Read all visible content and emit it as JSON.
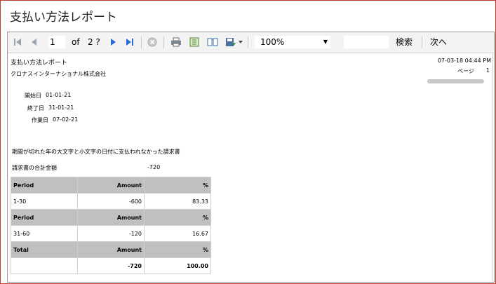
{
  "window": {
    "title": "支払い方法レポート"
  },
  "toolbar": {
    "page_current": "1",
    "page_of": "of",
    "page_total": "2 ?",
    "zoom": "100%",
    "find_label": "検索",
    "next_label": "次へ",
    "icons": [
      "first-page-icon",
      "previous-page-icon",
      "next-page-icon",
      "last-page-icon",
      "stop-icon",
      "print-icon",
      "page-setup-icon",
      "print-layout-icon",
      "export-icon",
      "dropdown-arrow-icon"
    ]
  },
  "report": {
    "title": "支払い方法レポート",
    "company": "クロナスインターナショナル株式会社",
    "timestamp": "07-03-18 04:44 PM",
    "page_label": "ページ",
    "page_number": "1",
    "start_label": "開始日",
    "start_value": "01-01-21",
    "end_label": "終了日",
    "end_value": "31-01-21",
    "run_label": "作業日",
    "run_value": "07-02-21",
    "description": "期間が切れた年の大文字と小文字の日付に支払われなかった請求書",
    "total_label": "請求書の合計金額",
    "total_value": "-720",
    "table": {
      "rows": [
        {
          "period_h": "Period",
          "amount_h": "Amount",
          "pct_h": "%",
          "period": "1-30",
          "amount": "-600",
          "pct": "83.33"
        },
        {
          "period_h": "Period",
          "amount_h": "Amount",
          "pct_h": "%",
          "period": "31-60",
          "amount": "-120",
          "pct": "16.67"
        }
      ],
      "total": {
        "label": "Total",
        "amount_h": "Amount",
        "pct_h": "%",
        "amount": "-720",
        "pct": "100.00"
      }
    }
  }
}
